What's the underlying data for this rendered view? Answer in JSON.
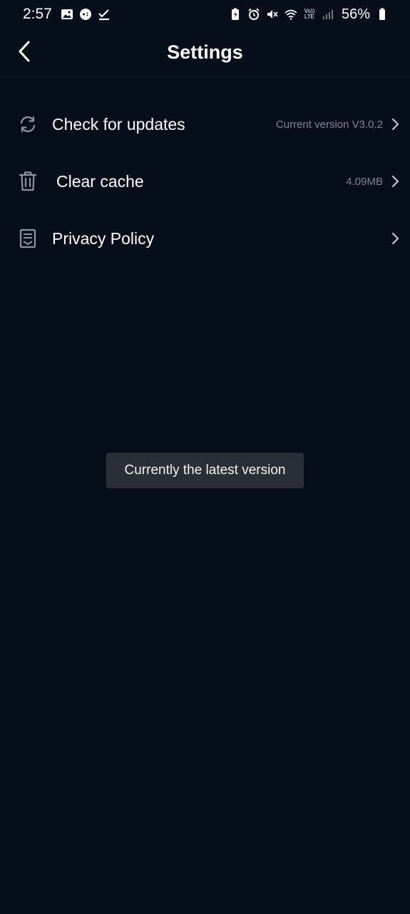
{
  "status_bar": {
    "time": "2:57",
    "battery": "56%",
    "network": "LTE",
    "volte": "Vo))"
  },
  "header": {
    "title": "Settings"
  },
  "settings": [
    {
      "label": "Check for updates",
      "value": "Current version V3.0.2",
      "icon": "refresh-icon"
    },
    {
      "label": "Clear cache",
      "value": "4.09MB",
      "icon": "trash-icon"
    },
    {
      "label": "Privacy Policy",
      "value": "",
      "icon": "document-icon"
    }
  ],
  "toast": {
    "message": "Currently the latest version"
  },
  "colors": {
    "background": "#060e1a",
    "secondary_text": "#7b8594",
    "toast_bg": "#2a2f37"
  }
}
